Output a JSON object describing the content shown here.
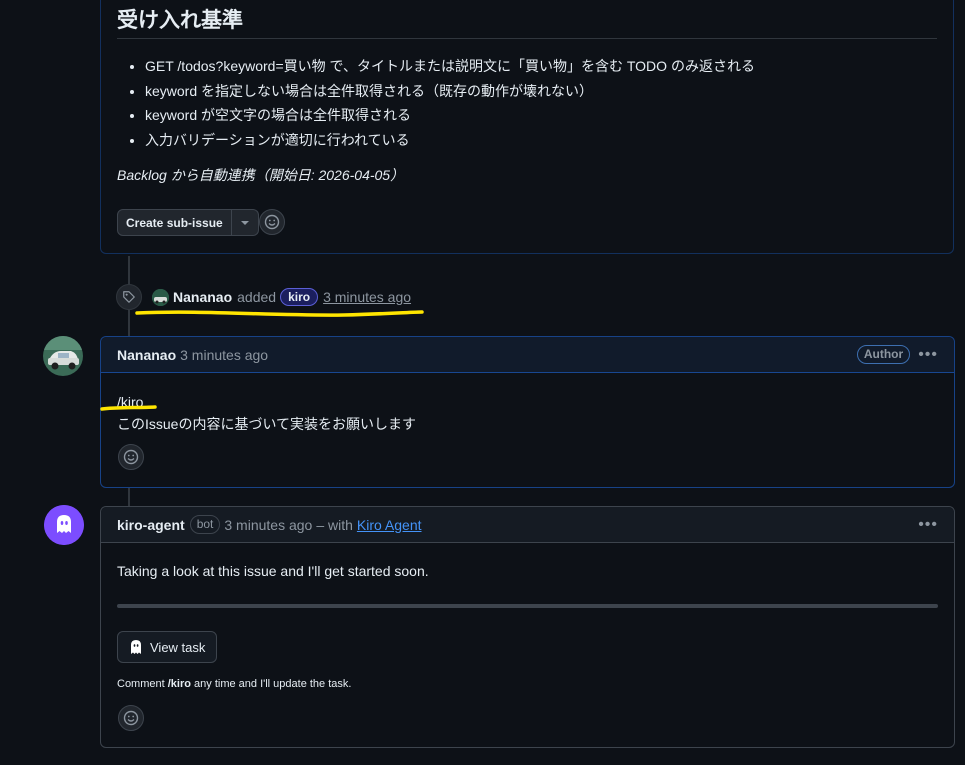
{
  "top_card": {
    "heading": "受け入れ基準",
    "criteria": [
      "GET /todos?keyword=買い物 で、タイトルまたは説明文に「買い物」を含む TODO のみ返される",
      "keyword を指定しない場合は全件取得される（既存の動作が壊れない）",
      "keyword が空文字の場合は全件取得される",
      "入力バリデーションが適切に行われている"
    ],
    "footer_italic": "Backlog から自動連携（開始日: 2026-04-05）",
    "create_sub_issue": "Create sub-issue"
  },
  "label_event": {
    "user": "Nananao",
    "action": "added",
    "label": "kiro",
    "time": "3 minutes ago"
  },
  "user_comment": {
    "user": "Nananao",
    "time": "3 minutes ago",
    "badge": "Author",
    "line1": "/kiro",
    "line2": "このIssueの内容に基づいて実装をお願いします"
  },
  "bot_comment": {
    "user": "kiro-agent",
    "badge": "bot",
    "time": "3 minutes ago",
    "with_text": "– with",
    "with_link": "Kiro Agent",
    "message": "Taking a look at this issue and I'll get started soon.",
    "view_task": "View task",
    "note_prefix": "Comment ",
    "note_cmd": "/kiro",
    "note_suffix": " any time and I'll update the task."
  },
  "colors": {
    "background": "#0d1117",
    "link": "#4493f8",
    "highlight": "#ffe600",
    "kiro_purple": "#7c4dff"
  },
  "icons": [
    "tag-icon",
    "smiley-icon",
    "triangle-down-icon",
    "kebab-icon",
    "ghost-icon"
  ]
}
